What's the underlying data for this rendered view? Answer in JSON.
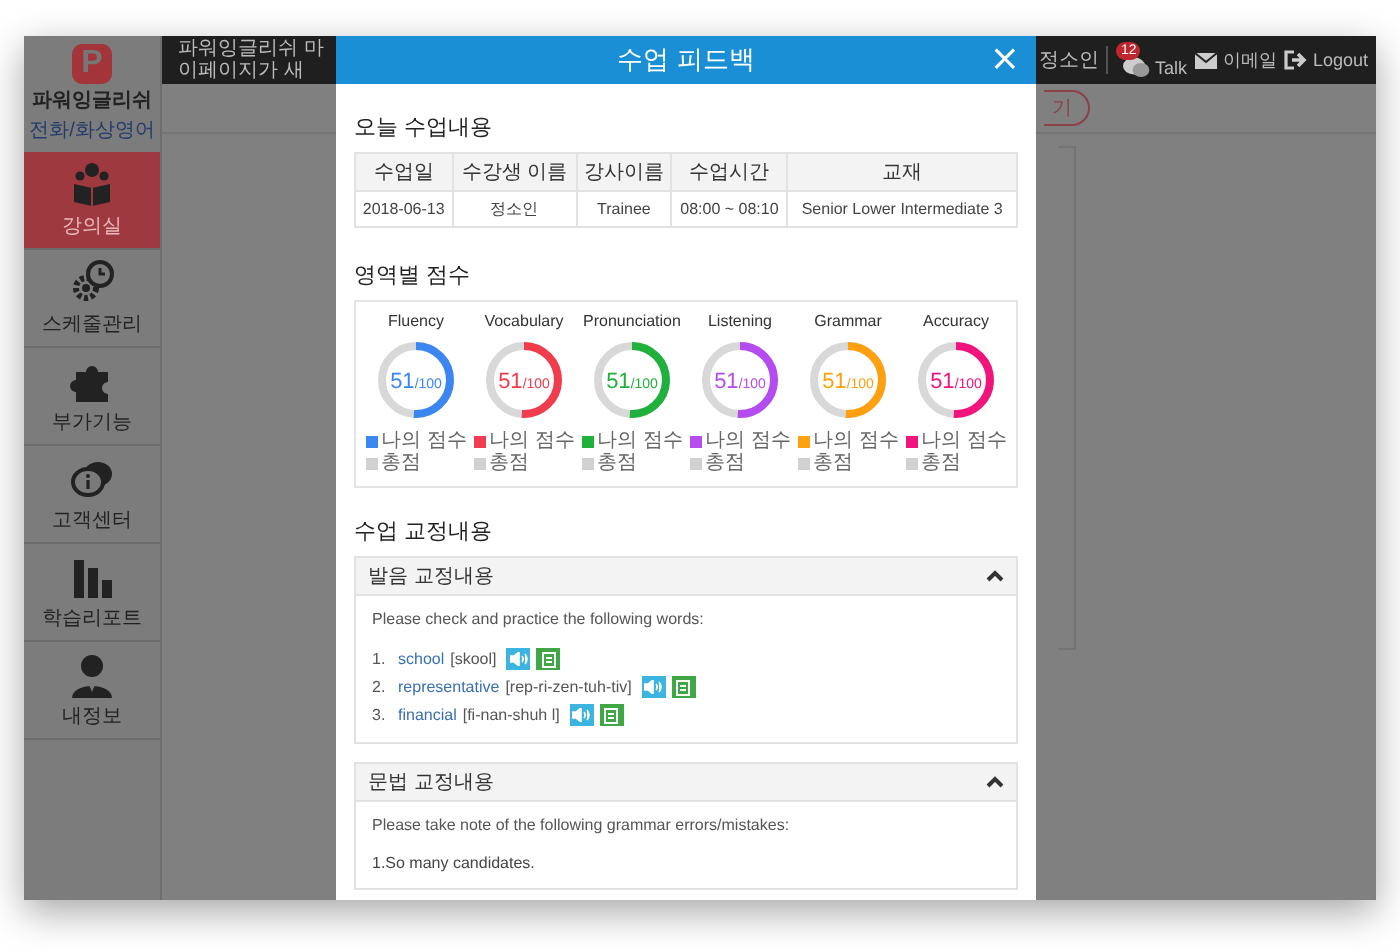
{
  "sidebar": {
    "logo_text": "P",
    "brand": "파워잉글리쉬",
    "subtitle": "전화/화상영어",
    "items": [
      {
        "label": "강의실",
        "kind": "reader",
        "selected": true
      },
      {
        "label": "스케줄관리",
        "kind": "gears",
        "selected": false
      },
      {
        "label": "부가기능",
        "kind": "puzzle",
        "selected": false
      },
      {
        "label": "고객센터",
        "kind": "bubbles",
        "selected": false
      },
      {
        "label": "학습리포트",
        "kind": "bars",
        "selected": false
      },
      {
        "label": "내정보",
        "kind": "person",
        "selected": false
      }
    ]
  },
  "top_bar": {
    "notice": "파워잉글리쉬 마이페이지가 새",
    "user": "정소인",
    "talk": {
      "label": "Talk",
      "badge": "12"
    },
    "email": "이메일",
    "logout": "Logout"
  },
  "background_button": "기",
  "modal": {
    "title": "수업 피드백",
    "close": "×",
    "lesson": {
      "heading": "오늘 수업내용",
      "columns": [
        "수업일",
        "수강생 이름",
        "강사이름",
        "수업시간",
        "교재"
      ],
      "row": [
        "2018-06-13",
        "정소인",
        "Trainee",
        "08:00 ~ 08:10",
        "Senior Lower Intermediate 3"
      ]
    },
    "scores": {
      "heading": "영역별 점수",
      "items": [
        {
          "name": "Fluency",
          "score": "51",
          "total": "/100",
          "level": 0.51,
          "color": "#3b86f0",
          "legend_mine": "나의 점수",
          "legend_total": "총점"
        },
        {
          "name": "Vocabulary",
          "score": "51",
          "total": "/100",
          "level": 0.51,
          "color": "#f03c4c",
          "legend_mine": "나의 점수",
          "legend_total": "총점"
        },
        {
          "name": "Pronunciation",
          "score": "51",
          "total": "/100",
          "level": 0.51,
          "color": "#20b03c",
          "legend_mine": "나의 점수",
          "legend_total": "총점"
        },
        {
          "name": "Listening",
          "score": "51",
          "total": "/100",
          "level": 0.51,
          "color": "#b44cf0",
          "legend_mine": "나의 점수",
          "legend_total": "총점"
        },
        {
          "name": "Grammar",
          "score": "51",
          "total": "/100",
          "level": 0.51,
          "color": "#ffa010",
          "legend_mine": "나의 점수",
          "legend_total": "총점"
        },
        {
          "name": "Accuracy",
          "score": "51",
          "total": "/100",
          "level": 0.51,
          "color": "#f0147c",
          "legend_mine": "나의 점수",
          "legend_total": "총점"
        }
      ]
    },
    "corrections": {
      "heading": "수업 교정내용",
      "panels": [
        {
          "title": "발음 교정내용",
          "expanded": true,
          "intro": "Please check and practice the following words:",
          "words": [
            {
              "number": "1.",
              "word": "school",
              "phonetic": "[skool]"
            },
            {
              "number": "2.",
              "word": "representative",
              "phonetic": "[rep-ri-zen-tuh-tiv]"
            },
            {
              "number": "3.",
              "word": "financial",
              "phonetic": "[fi-nan-shuh l]"
            }
          ]
        },
        {
          "title": "문법 교정내용",
          "expanded": true,
          "intro": "Please take note of the following grammar errors/mistakes:",
          "lines": [
            "1.So many candidates."
          ]
        }
      ]
    }
  }
}
